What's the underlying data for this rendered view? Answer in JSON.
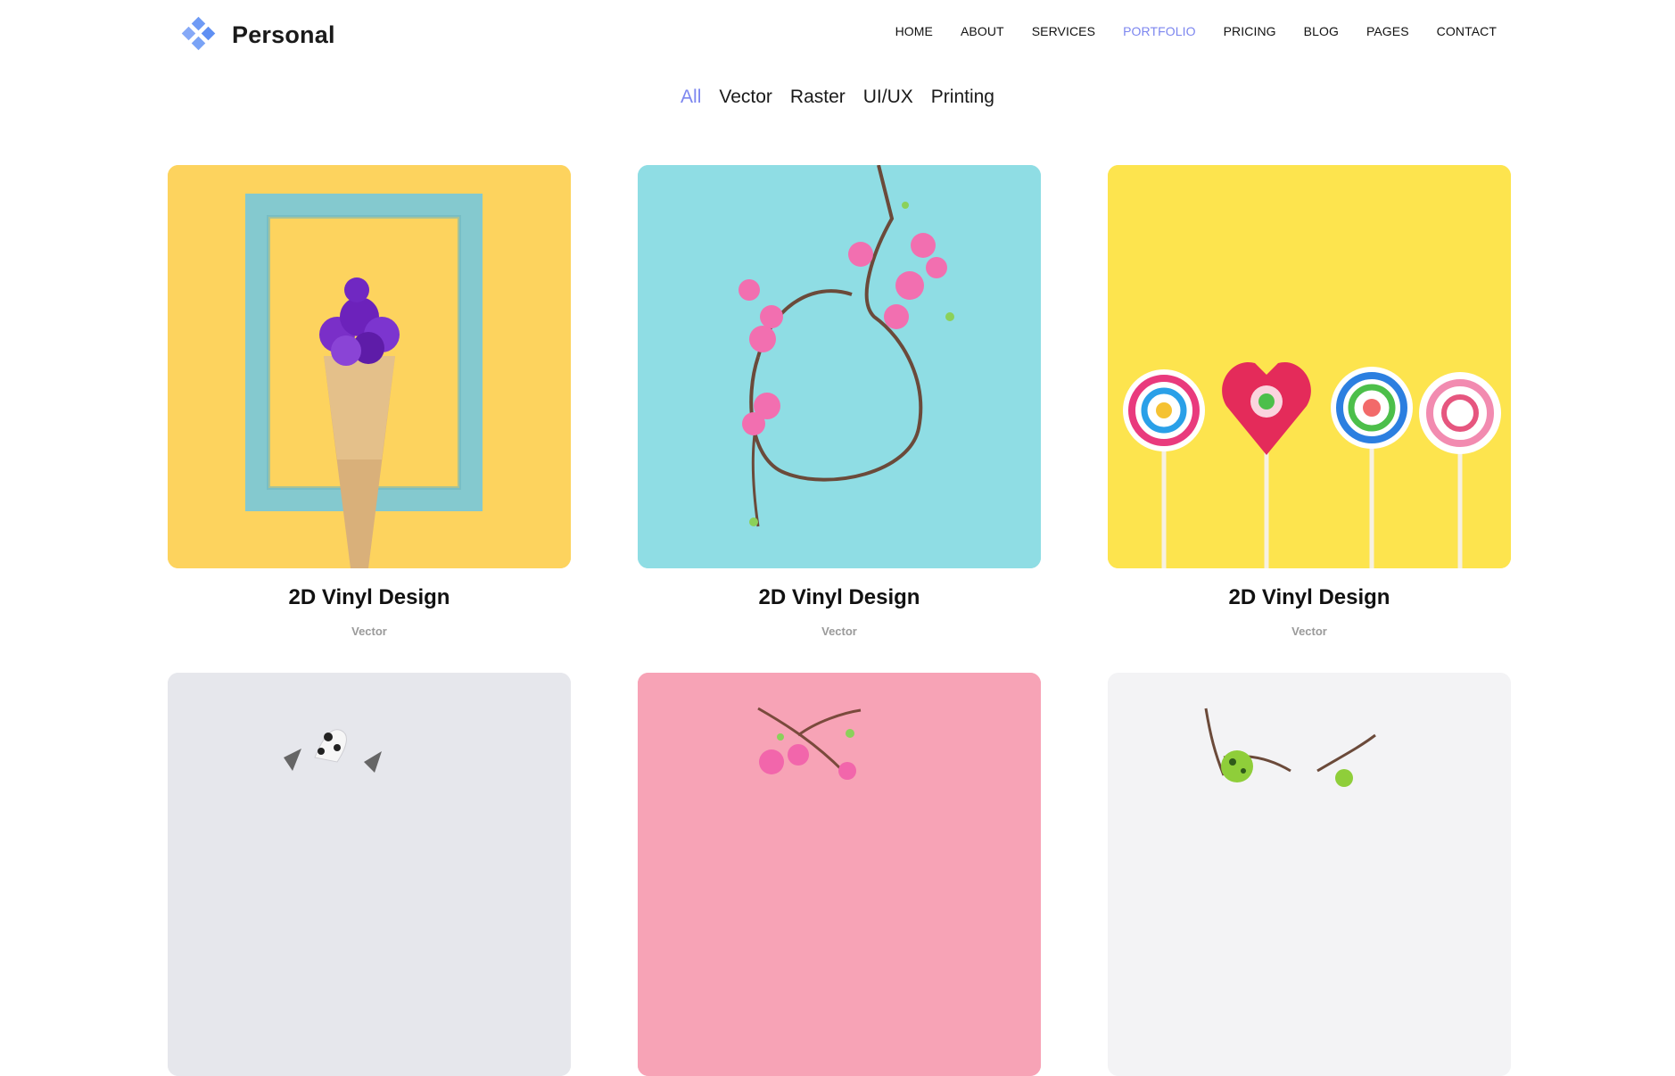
{
  "brand": {
    "name": "Personal",
    "icon": "diamond-cluster-icon",
    "accent": "#7c86ef"
  },
  "nav": {
    "items": [
      {
        "label": "HOME",
        "active": false
      },
      {
        "label": "ABOUT",
        "active": false
      },
      {
        "label": "SERVICES",
        "active": false
      },
      {
        "label": "PORTFOLIO",
        "active": true
      },
      {
        "label": "PRICING",
        "active": false
      },
      {
        "label": "BLOG",
        "active": false
      },
      {
        "label": "PAGES",
        "active": false
      },
      {
        "label": "CONTACT",
        "active": false
      }
    ]
  },
  "filters": {
    "items": [
      {
        "label": "All",
        "active": true
      },
      {
        "label": "Vector",
        "active": false
      },
      {
        "label": "Raster",
        "active": false
      },
      {
        "label": "UI/UX",
        "active": false
      },
      {
        "label": "Printing",
        "active": false
      }
    ]
  },
  "portfolio": {
    "items": [
      {
        "title": "2D Vinyl Design",
        "category": "Vector",
        "image": "ice-cream-cone-flowers-frame",
        "bg": "#fdd35e"
      },
      {
        "title": "2D Vinyl Design",
        "category": "Vector",
        "image": "flower-branch-circle",
        "bg": "#8fdde4"
      },
      {
        "title": "2D Vinyl Design",
        "category": "Vector",
        "image": "lollipops",
        "bg": "#fde44e"
      },
      {
        "image": "dalmatian-figurine",
        "bg": "#e6e7ec"
      },
      {
        "image": "pink-blossom-branch",
        "bg": "#f7a3b6"
      },
      {
        "image": "green-berries-twigs",
        "bg": "#f3f3f5"
      }
    ]
  }
}
